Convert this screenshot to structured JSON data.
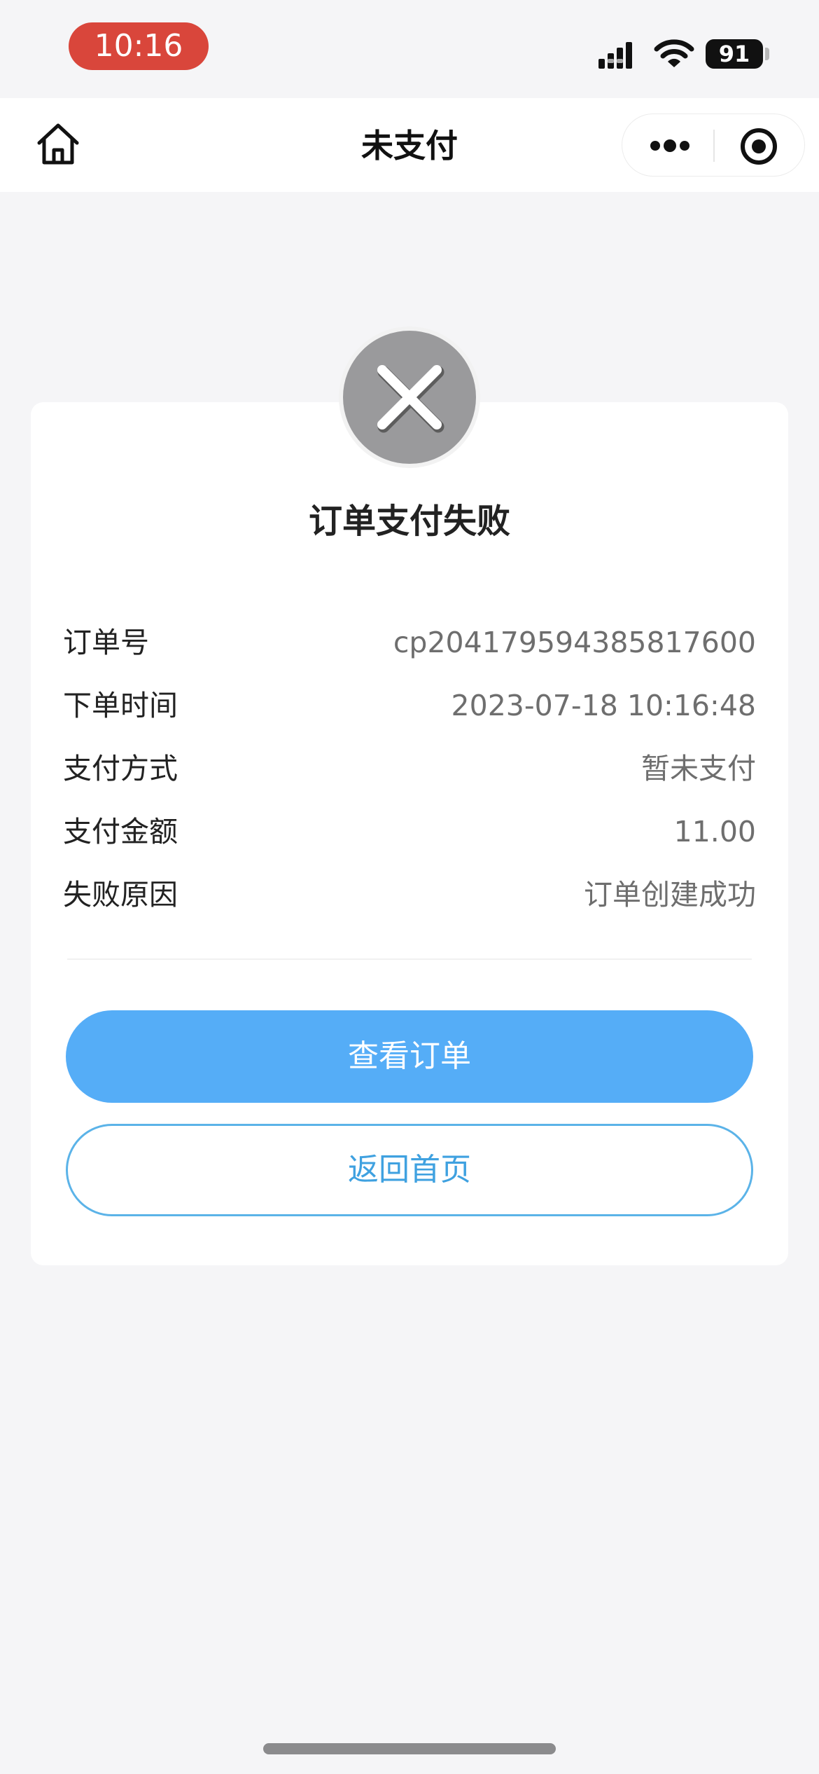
{
  "status_bar": {
    "time": "10:16",
    "battery": "91",
    "time_pill_color": "#d9463b"
  },
  "nav": {
    "title": "未支付",
    "home_icon": "home-icon",
    "more_icon": "more-dots-icon",
    "close_icon": "target-circle-icon"
  },
  "result": {
    "status_icon": "close-x-icon",
    "title": "订单支付失败"
  },
  "order_info": [
    {
      "label": "订单号",
      "value": "cp204179594385817600"
    },
    {
      "label": "下单时间",
      "value": "2023-07-18 10:16:48"
    },
    {
      "label": "支付方式",
      "value": "暂未支付"
    },
    {
      "label": "支付金额",
      "value": "11.00"
    },
    {
      "label": "失败原因",
      "value": "订单创建成功"
    }
  ],
  "actions": {
    "view_order_label": "查看订单",
    "back_home_label": "返回首页",
    "primary_color": "#55adf7",
    "outline_color": "#5bb3e8"
  }
}
